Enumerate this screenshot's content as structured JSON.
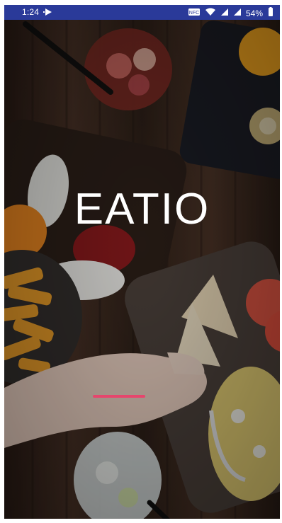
{
  "status_bar": {
    "time": "1:24",
    "battery": "54%",
    "icons": [
      "play-notification-icon",
      "nfc-icon",
      "wifi-icon",
      "cell-signal-icon",
      "cell-signal-icon-2",
      "battery-icon"
    ]
  },
  "splash": {
    "title": "EATIO"
  },
  "colors": {
    "status_bar_bg": "#2a3a99",
    "accent": "#e6466d"
  }
}
